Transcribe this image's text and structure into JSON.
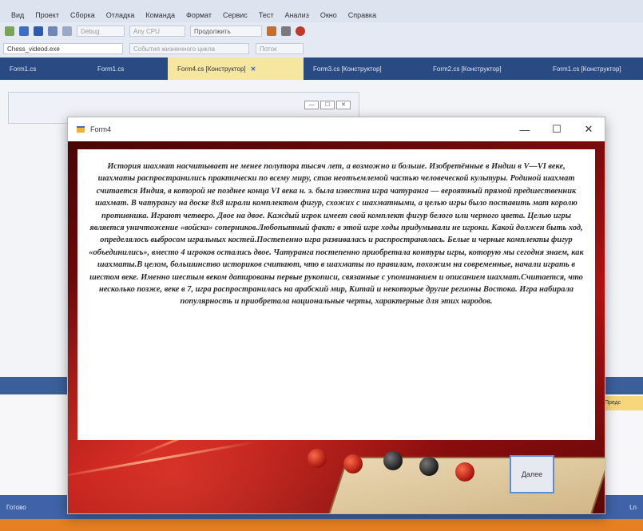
{
  "ide": {
    "menu": [
      "Вид",
      "Проект",
      "Сборка",
      "Отладка",
      "Команда",
      "Формат",
      "Сервис",
      "Тест",
      "Анализ",
      "Окно",
      "Справка"
    ],
    "toolbar": {
      "config_box": "Debug",
      "platform_box": "Any CPU",
      "start_button": "Продолжить"
    },
    "config_bar": {
      "project_select": "Chess_videod.exe",
      "event_box": "События жизненного цикла",
      "thread_box": "Поток"
    },
    "tabs": [
      {
        "label": "Form1.cs",
        "active": false
      },
      {
        "label": "Form1.cs",
        "active": false
      },
      {
        "label": "Form4.cs [Конструктор]",
        "active": true
      },
      {
        "label": "Form3.cs [Конструктор]",
        "active": false
      },
      {
        "label": "Form2.cs [Конструктор]",
        "active": false
      },
      {
        "label": "Form1.cs [Конструктор]",
        "active": false
      }
    ],
    "right_badge": "Предс",
    "status_left": "Готово",
    "status_right": "Ln"
  },
  "form": {
    "title": "Form4",
    "minimize": "—",
    "maximize": "☐",
    "close": "✕",
    "text": "История шахмат насчитывает не менее полутора тысяч лет, а возможно и больше. Изобретённые в Индии в V—VI веке, шахматы распространились практически по всему миру, став неотъемлемой частью человеческой культуры. Родиной шахмат считается Индия, в которой не позднее конца VI века н. э. была известна игра чатуранга — вероятный прямой предшественник шахмат. В чатурангу на доске 8х8 играли комплектом фигур, схожих с шахматными, а целью игры было поставить мат королю противника. Играют четверо. Двое на двое. Каждый игрок имеет свой комплект фигур белого или черного цвета. Целью игры является уничтожение «войска» соперников.Любопытный факт: в этой игре ходы придумывали не игроки. Какой должен быть ход, определялось выбросом игральных костей.Постепенно игра развивалась и распространялась. Белые и черные комплекты фигур «объединились», вместо 4 игроков остались двое. Чатуранга постепенно приобретала контуры игры, которую мы сегодня знаем, как шахматы.В целом, большинство историков считают, что в шахматы по правилам, похожим на современные, начали играть в шестом веке. Именно шестым веком датированы первые рукописи, связанные с упоминанием и описанием шахмат.Считается, что несколько позже, веке в 7, игра распространилась на арабский мир, Китай и некоторые другие регионы Востока. Игра набирала популярность и приобретала национальные черты, характерные для этих народов.",
    "next_button": "Далее"
  },
  "colors": {
    "tab_bar": "#294a82",
    "active_tab": "#f5e7a0",
    "status_bar": "#3f63a6",
    "accent_orange": "#e67e22",
    "form_background_red": "#b01212",
    "button_border": "#5a8fd8"
  },
  "icons": [
    "new-file-icon",
    "save-icon",
    "save-all-icon",
    "undo-icon",
    "redo-icon",
    "start-icon",
    "stop-icon",
    "breakpoint-icon",
    "app-icon"
  ]
}
